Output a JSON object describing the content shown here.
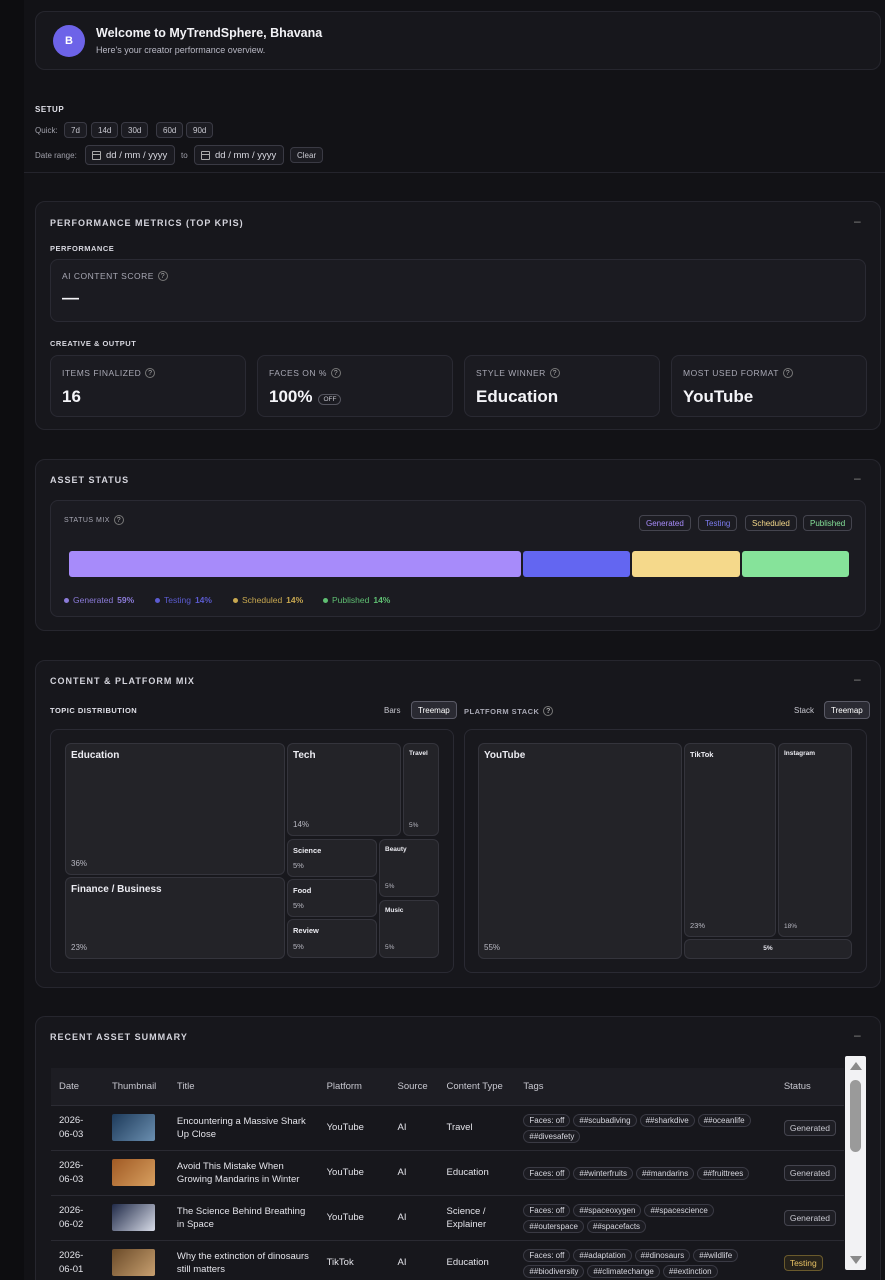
{
  "welcome": {
    "avatar_initial": "B",
    "title": "Welcome to MyTrendSphere, Bhavana",
    "subtitle": "Here's your creator performance overview."
  },
  "setup": {
    "title": "SETUP",
    "quick_label": "Quick:",
    "quick_options": [
      "7d",
      "14d",
      "30d",
      "60d",
      "90d"
    ],
    "date_range_label": "Date range:",
    "from_placeholder": "dd / mm / yyyy",
    "to_label": "to",
    "to_placeholder": "dd / mm / yyyy",
    "clear_label": "Clear"
  },
  "performance": {
    "title": "PERFORMANCE METRICS (TOP KPIS)",
    "collapse": "–",
    "section_label": "PERFORMANCE",
    "ai_score_label": "AI CONTENT SCORE",
    "ai_score_value": "—",
    "creative_label": "CREATIVE & OUTPUT",
    "kpis": [
      {
        "label": "ITEMS FINALIZED",
        "value": "16"
      },
      {
        "label": "FACES ON %",
        "value": "100%",
        "badge": "OFF"
      },
      {
        "label": "STYLE WINNER",
        "value": "Education"
      },
      {
        "label": "MOST USED FORMAT",
        "value": "YouTube"
      }
    ]
  },
  "asset_status": {
    "title": "ASSET STATUS",
    "collapse": "–",
    "status_mix_label": "STATUS MIX",
    "filters": [
      {
        "label": "Generated",
        "color": "#a78bfa"
      },
      {
        "label": "Testing",
        "color": "#7c7cf0"
      },
      {
        "label": "Scheduled",
        "color": "#f5d98b"
      },
      {
        "label": "Published",
        "color": "#86e39a"
      }
    ],
    "segments": [
      {
        "name": "Generated",
        "percent": 59,
        "color": "#a78bfa"
      },
      {
        "name": "Testing",
        "percent": 14,
        "color": "#6366f1"
      },
      {
        "name": "Scheduled",
        "percent": 14,
        "color": "#f5d98b"
      },
      {
        "name": "Published",
        "percent": 14,
        "color": "#86e39a"
      }
    ],
    "legend": [
      {
        "name": "Generated",
        "value": "59%",
        "color": "#8b7bd8"
      },
      {
        "name": "Testing",
        "value": "14%",
        "color": "#5b5bd0"
      },
      {
        "name": "Scheduled",
        "value": "14%",
        "color": "#c8a850"
      },
      {
        "name": "Published",
        "value": "14%",
        "color": "#5fbf72"
      }
    ]
  },
  "content_mix": {
    "title": "CONTENT & PLATFORM MIX",
    "collapse": "–",
    "topic_title": "TOPIC DISTRIBUTION",
    "topic_toggle": [
      "Bars",
      "Treemap"
    ],
    "platform_title": "PLATFORM STACK",
    "platform_toggle": [
      "Stack",
      "Treemap"
    ],
    "topics": [
      {
        "name": "Education",
        "pct": "36%"
      },
      {
        "name": "Tech",
        "pct": "14%"
      },
      {
        "name": "Travel",
        "pct": "5%"
      },
      {
        "name": "Science",
        "pct": "5%"
      },
      {
        "name": "Beauty",
        "pct": "5%"
      },
      {
        "name": "Finance / Business",
        "pct": "23%"
      },
      {
        "name": "Food",
        "pct": "5%"
      },
      {
        "name": "Music",
        "pct": "5%"
      },
      {
        "name": "Review",
        "pct": "5%"
      }
    ],
    "platforms": [
      {
        "name": "YouTube",
        "pct": "55%"
      },
      {
        "name": "TikTok",
        "pct": "23%"
      },
      {
        "name": "Instagram",
        "pct": "18%"
      },
      {
        "name": "",
        "pct": "5%"
      }
    ]
  },
  "recent": {
    "title": "RECENT ASSET SUMMARY",
    "collapse": "–",
    "columns": [
      "Date",
      "Thumbnail",
      "Title",
      "Platform",
      "Source",
      "Content Type",
      "Tags",
      "Status"
    ],
    "rows": [
      {
        "date": "2026-06-03",
        "title": "Encountering a Massive Shark Up Close",
        "platform": "YouTube",
        "source": "AI",
        "type": "Travel",
        "tags": [
          "Faces: off",
          "##scubadiving",
          "##sharkdive",
          "##oceanlife",
          "##divesafety"
        ],
        "status": "Generated",
        "thumb": [
          "#1d3a5a",
          "#6b8fb0"
        ]
      },
      {
        "date": "2026-06-03",
        "title": "Avoid This Mistake When Growing Mandarins in Winter",
        "platform": "YouTube",
        "source": "AI",
        "type": "Education",
        "tags": [
          "Faces: off",
          "##winterfruits",
          "##mandarins",
          "##fruittrees"
        ],
        "status": "Generated",
        "thumb": [
          "#a05a24",
          "#d8a060"
        ]
      },
      {
        "date": "2026-06-02",
        "title": "The Science Behind Breathing in Space",
        "platform": "YouTube",
        "source": "AI",
        "type": "Science / Explainer",
        "tags": [
          "Faces: off",
          "##spaceoxygen",
          "##spacescience",
          "##outerspace",
          "##spacefacts"
        ],
        "status": "Generated",
        "thumb": [
          "#202a48",
          "#d8dce8"
        ]
      },
      {
        "date": "2026-06-01",
        "title": "Why the extinction of dinosaurs still matters",
        "platform": "TikTok",
        "source": "AI",
        "type": "Education",
        "tags": [
          "Faces: off",
          "##adaptation",
          "##dinosaurs",
          "##wildlife",
          "##biodiversity",
          "##climatechange",
          "##extinction"
        ],
        "status": "Testing",
        "thumb": [
          "#6a4a28",
          "#c8a070"
        ]
      }
    ]
  }
}
